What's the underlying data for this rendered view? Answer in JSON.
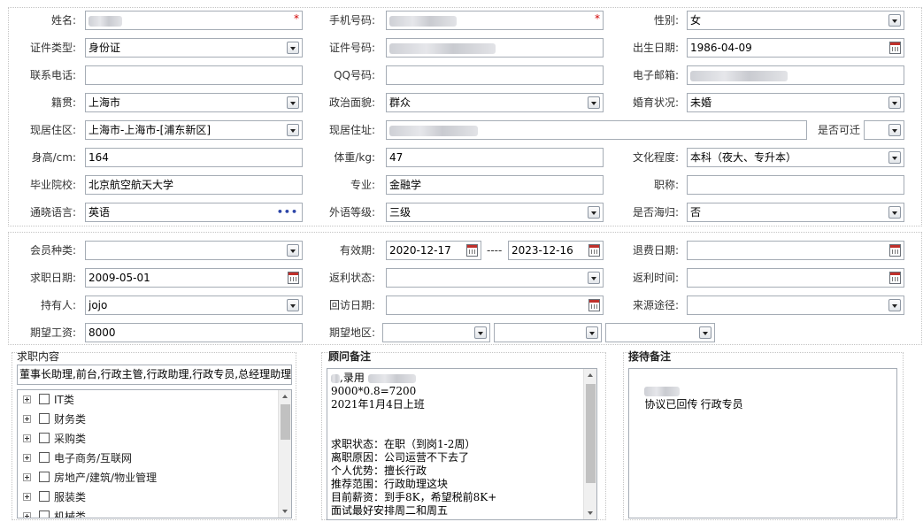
{
  "section1": {
    "name": {
      "label": "姓名:",
      "required_mark": "*"
    },
    "mobile": {
      "label": "手机号码:",
      "required_mark": "*"
    },
    "gender": {
      "label": "性别:",
      "value": "女"
    },
    "id_type": {
      "label": "证件类型:",
      "value": "身份证"
    },
    "id_number": {
      "label": "证件号码:"
    },
    "birth_date": {
      "label": "出生日期:",
      "value": "1986-04-09"
    },
    "phone": {
      "label": "联系电话:",
      "value": ""
    },
    "qq": {
      "label": "QQ号码:",
      "value": ""
    },
    "email": {
      "label": "电子邮箱:"
    },
    "native_place": {
      "label": "籍贯:",
      "value": "上海市"
    },
    "political": {
      "label": "政治面貌:",
      "value": "群众"
    },
    "marital": {
      "label": "婚育状况:",
      "value": "未婚"
    },
    "residence_area": {
      "label": "现居住区:",
      "value": "上海市-上海市-[浦东新区]"
    },
    "residence_address": {
      "label": "现居住址:"
    },
    "relocate": {
      "label": "是否可迁",
      "value": ""
    },
    "height": {
      "label": "身高/cm:",
      "value": "164"
    },
    "weight": {
      "label": "体重/kg:",
      "value": "47"
    },
    "education": {
      "label": "文化程度:",
      "value": "本科（夜大、专升本）"
    },
    "school": {
      "label": "毕业院校:",
      "value": "北京航空航天大学"
    },
    "major": {
      "label": "专业:",
      "value": "金融学"
    },
    "title": {
      "label": "职称:",
      "value": ""
    },
    "language": {
      "label": "通晓语言:",
      "value": "英语",
      "more": "•••"
    },
    "foreign_level": {
      "label": "外语等级:",
      "value": "三级"
    },
    "returnee": {
      "label": "是否海归:",
      "value": "否"
    }
  },
  "section2": {
    "member_type": {
      "label": "会员种类:",
      "value": ""
    },
    "valid_period": {
      "label": "有效期:",
      "start": "2020-12-17",
      "separator": "----",
      "end": "2023-12-16"
    },
    "refund_date": {
      "label": "退费日期:",
      "value": ""
    },
    "apply_date": {
      "label": "求职日期:",
      "value": "2009-05-01"
    },
    "rebate_status": {
      "label": "返利状态:",
      "value": ""
    },
    "rebate_time": {
      "label": "返利时间:",
      "value": ""
    },
    "holder": {
      "label": "持有人:",
      "value": "jojo"
    },
    "visit_date": {
      "label": "回访日期:",
      "value": ""
    },
    "source": {
      "label": "来源途径:",
      "value": ""
    },
    "expected_salary": {
      "label": "期望工资:",
      "value": "8000"
    },
    "expected_area": {
      "label": "期望地区:"
    }
  },
  "job_content": {
    "title": "求职内容",
    "selected_text": "董事长助理,前台,行政主管,行政助理,行政专员,总经理助理",
    "categories": [
      "IT类",
      "财务类",
      "采购类",
      "电子商务/互联网",
      "房地产/建筑/物业管理",
      "服装类",
      "机械类"
    ]
  },
  "consultant_notes": {
    "title": "顾问备注",
    "lines": [
      ",录用",
      "9000*0.8=7200",
      "2021年1月4日上班",
      "",
      "",
      "求职状态：在职（到岗1-2周）",
      "离职原因：公司运营不下去了",
      "个人优势：擅长行政",
      "推荐范围：行政助理这块",
      "目前薪资：到手8K，希望税前8K+",
      "面试最好安排周二和周五"
    ]
  },
  "reception_notes": {
    "title": "接待备注",
    "text": "协议已回传 行政专员"
  }
}
